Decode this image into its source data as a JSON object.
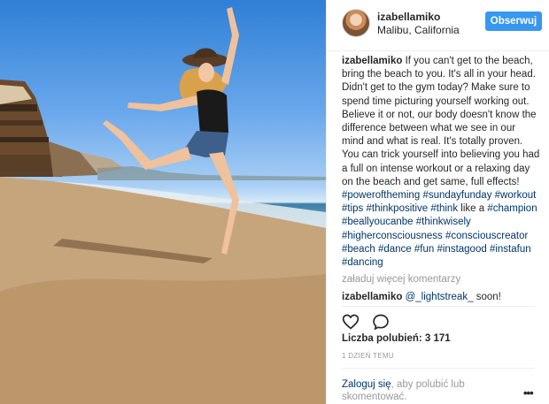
{
  "photo": {
    "alt_name": "beach-dance-photo"
  },
  "header": {
    "username": "izabellamiko",
    "location": "Malibu, California",
    "follow_label": "Obserwuj"
  },
  "caption": {
    "author": "izabellamiko",
    "text": "If you can't get to the beach, bring the beach to you. It's all in your head. Didn't get to the gym today? Make sure to spend time picturing yourself working out. Believe it or not, our body doesn't know the difference between what we see in our mind and what is real. It's totally proven. You can trick yourself into believing you had a full on intense workout or a relaxing day on the beach and get same, full effects!",
    "hashtags_line1": [
      "#poweroftheming"
    ],
    "tags": [
      "#poweroftheming",
      "#sundayfunday",
      "#workout",
      "#tips",
      "#thinkpositive",
      "#think",
      "#champion",
      "#beallyoucanbe",
      "#thinkwisely",
      "#higherconsciousness",
      "#consciouscreator",
      "#beach",
      "#dance",
      "#fun",
      "#instagood",
      "#instafun",
      "#dancing"
    ],
    "word_like": "like a"
  },
  "load_more": "załaduj więcej komentarzy",
  "comment": {
    "author": "izabellamiko",
    "mention": "@_lightstreak_",
    "text": "soon!"
  },
  "actions": {
    "like_icon": "heart-icon",
    "comment_icon": "comment-bubble-icon"
  },
  "likes": "Liczba polubień: 3 171",
  "time": "1 DZIEŃ TEMU",
  "login": {
    "link": "Zaloguj się",
    "rest": ", aby polubić lub skomentować."
  },
  "more_label": "•••"
}
